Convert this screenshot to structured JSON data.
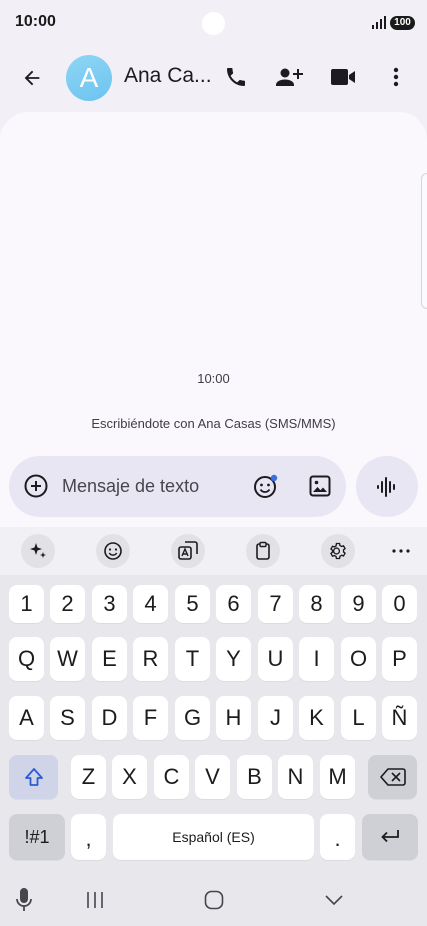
{
  "status": {
    "time": "10:00",
    "battery": "100"
  },
  "header": {
    "avatar_letter": "A",
    "contact_name": "Ana Ca..."
  },
  "conversation": {
    "timestamp": "10:00",
    "info": "Escribiéndote con Ana Casas (SMS/MMS)"
  },
  "compose": {
    "placeholder": "Mensaje de texto"
  },
  "keyboard": {
    "row_numbers": [
      "1",
      "2",
      "3",
      "4",
      "5",
      "6",
      "7",
      "8",
      "9",
      "0"
    ],
    "row_q": [
      "Q",
      "W",
      "E",
      "R",
      "T",
      "Y",
      "U",
      "I",
      "O",
      "P"
    ],
    "row_a": [
      "A",
      "S",
      "D",
      "F",
      "G",
      "H",
      "J",
      "K",
      "L",
      "Ñ"
    ],
    "row_z": [
      "Z",
      "X",
      "C",
      "V",
      "B",
      "N",
      "M"
    ],
    "symbols_label": "!#1",
    "comma_label": ",",
    "space_label": "Español (ES)",
    "period_label": "."
  },
  "colors": {
    "avatar": "#6cc4f0",
    "shift_key": "#cfd4e8",
    "compose_bg": "#e8e6f3"
  }
}
